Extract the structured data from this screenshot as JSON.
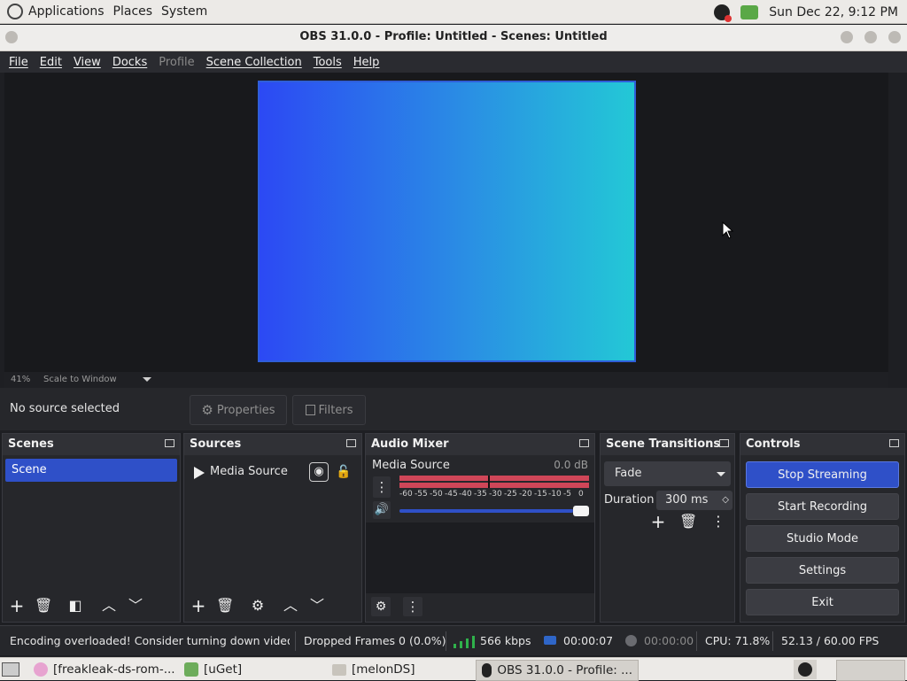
{
  "top_panel": {
    "menus": [
      "Applications",
      "Places",
      "System"
    ],
    "clock": "Sun Dec 22,  9:12 PM"
  },
  "window": {
    "title": "OBS 31.0.0 - Profile: Untitled - Scenes: Untitled"
  },
  "menubar": {
    "items": [
      {
        "label": "File",
        "enabled": true
      },
      {
        "label": "Edit",
        "enabled": true
      },
      {
        "label": "View",
        "enabled": true
      },
      {
        "label": "Docks",
        "enabled": true
      },
      {
        "label": "Profile",
        "enabled": false
      },
      {
        "label": "Scene Collection",
        "enabled": true
      },
      {
        "label": "Tools",
        "enabled": true
      },
      {
        "label": "Help",
        "enabled": true
      }
    ]
  },
  "preview": {
    "zoom": "41%",
    "scale_mode": "Scale to Window",
    "gradient_colors": [
      "#2c49f4",
      "#23c8d6"
    ]
  },
  "source_toolbar": {
    "status": "No source selected",
    "properties_label": "Properties",
    "filters_label": "Filters"
  },
  "scenes": {
    "title": "Scenes",
    "items": [
      "Scene"
    ],
    "selected": "Scene"
  },
  "sources": {
    "title": "Sources",
    "items": [
      {
        "name": "Media Source",
        "visible": true,
        "locked": false
      }
    ]
  },
  "audio_mixer": {
    "title": "Audio Mixer",
    "channel": "Media Source",
    "level": "0.0 dB",
    "scale_labels": [
      "-60",
      "-55",
      "-50",
      "-45",
      "-40",
      "-35",
      "-30",
      "-25",
      "-20",
      "-15",
      "-10",
      "-5",
      "0"
    ],
    "volume_fraction": 1.0
  },
  "scene_transitions": {
    "title": "Scene Transitions",
    "transition": "Fade",
    "duration_label": "Duration",
    "duration_value": "300 ms"
  },
  "controls": {
    "title": "Controls",
    "buttons": [
      "Stop Streaming",
      "Start Recording",
      "Studio Mode",
      "Settings",
      "Exit"
    ],
    "accent": "#2f50c8"
  },
  "status_bar": {
    "message": "Encoding overloaded! Consider turning down video s",
    "dropped_frames": "Dropped Frames 0 (0.0%)",
    "bitrate": "566 kbps",
    "stream_time": "00:00:07",
    "record_time": "00:00:00",
    "cpu": "CPU: 71.8%",
    "fps": "52.13 / 60.00 FPS"
  },
  "taskbar": {
    "tasks": [
      "[freakleak-ds-rom-...",
      "[uGet]",
      "[melonDS]",
      "OBS 31.0.0 - Profile: ..."
    ]
  }
}
